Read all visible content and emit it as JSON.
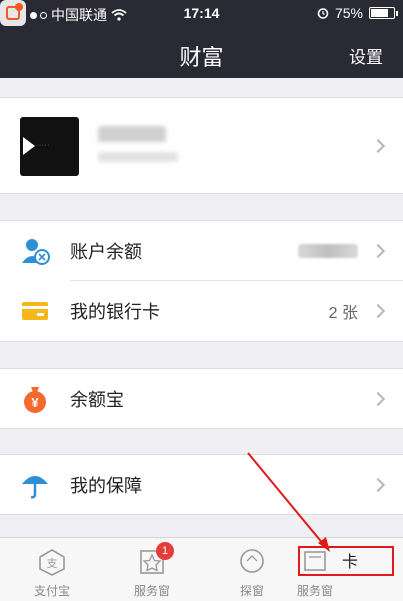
{
  "statusbar": {
    "carrier": "中国联通",
    "time": "17:14",
    "battery": "75%"
  },
  "navbar": {
    "title": "财富",
    "settings": "设置"
  },
  "rows": {
    "balance": "账户余额",
    "bankcard": "我的银行卡",
    "bankcard_value": "2 张",
    "yuebao": "余额宝",
    "insurance": "我的保障"
  },
  "tabs": [
    {
      "label": "支付宝",
      "icon": "alipay-icon"
    },
    {
      "label": "服务窗",
      "icon": "star-icon",
      "badge": "1"
    },
    {
      "label": "探窗",
      "icon": "discover-icon"
    },
    {
      "label": "服务窗",
      "icon": "service-window-icon"
    },
    {
      "label": "卡"
    }
  ],
  "colors": {
    "nav": "#2a2a34",
    "yuebao": "#f36a2e",
    "bankcard": "#f5b818",
    "insurance": "#2f8fd6",
    "annotation": "#e01a1a"
  }
}
